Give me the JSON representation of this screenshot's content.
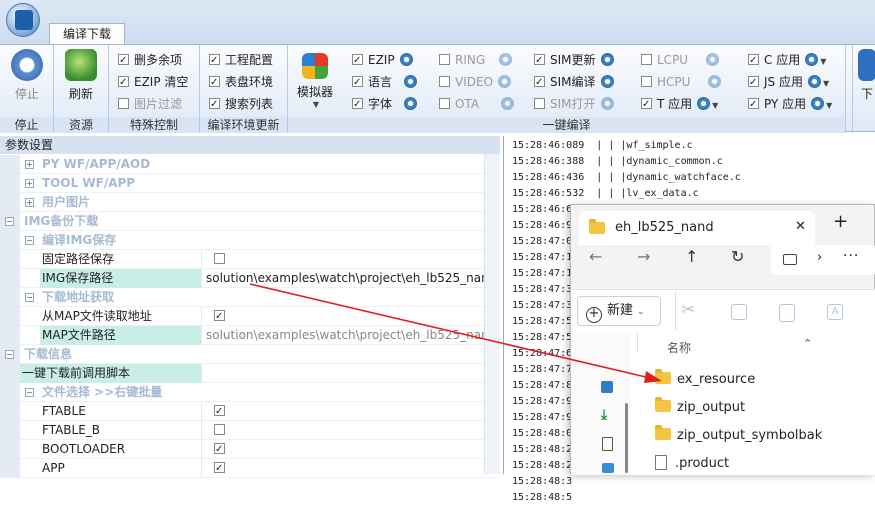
{
  "ribbon": {
    "tab": "编译下载",
    "groups": {
      "stop": {
        "button": "停止",
        "label": "停止"
      },
      "resource": {
        "button": "刷新",
        "label": "资源"
      },
      "special": {
        "items": [
          "删多余项",
          "EZIP 清空",
          "图片过滤"
        ],
        "label": "特殊控制"
      },
      "env": {
        "items": [
          "工程配置",
          "表盘环境",
          "搜索列表"
        ],
        "label": "编译环境更新"
      },
      "simulator": {
        "button": "模拟器"
      },
      "oneclick": {
        "label": "一键编译",
        "col1": [
          "EZIP",
          "语言",
          "字体"
        ],
        "col2": [
          "RING",
          "VIDEO",
          "OTA"
        ],
        "col3": [
          "SIM更新",
          "SIM编译",
          "SIM打开"
        ],
        "col4": [
          "LCPU",
          "HCPU",
          "T 应用"
        ],
        "col5": [
          "C 应用",
          "JS 应用",
          "PY 应用"
        ]
      },
      "download": {
        "button": "下"
      }
    }
  },
  "params": {
    "header": "参数设置",
    "rows": [
      {
        "name": "PY WF/APP/AOD",
        "value": ""
      },
      {
        "name": "TOOL WF/APP",
        "value": ""
      },
      {
        "name": "用户图片",
        "value": ""
      },
      {
        "name": "IMG备份下载",
        "value": ""
      },
      {
        "name": "编译IMG保存",
        "value": ""
      },
      {
        "name": "固定路径保存",
        "value": ""
      },
      {
        "name": "IMG保存路径",
        "value": "solution\\examples\\watch\\project\\eh_lb525_nand\\..."
      },
      {
        "name": "下载地址获取",
        "value": ""
      },
      {
        "name": "从MAP文件读取地址",
        "value": ""
      },
      {
        "name": "MAP文件路径",
        "value": "solution\\examples\\watch\\project\\eh_lb525_nand\\..."
      },
      {
        "name": "下载信息",
        "value": ""
      },
      {
        "name": "一键下载前调用脚本",
        "value": ""
      },
      {
        "name": "文件选择 >>右键批量",
        "value": ""
      },
      {
        "name": "FTABLE",
        "value": ""
      },
      {
        "name": "FTABLE_B",
        "value": ""
      },
      {
        "name": "BOOTLOADER",
        "value": ""
      },
      {
        "name": "APP",
        "value": ""
      }
    ]
  },
  "log": {
    "lines": [
      "15:28:46:089  | | |wf_simple.c",
      "15:28:46:388  | | |dynamic_common.c",
      "15:28:46:436  | | |dynamic_watchface.c",
      "15:28:46:532  | | |lv_ex_data.c",
      "15:28:46:6",
      "15:28:46:9",
      "15:28:47:0",
      "15:28:47:1",
      "15:28:47:1",
      "15:28:47:3",
      "15:28:47:3",
      "15:28:47:5",
      "15:28:47:5",
      "15:28:47:6",
      "15:28:47:7",
      "15:28:47:8",
      "15:28:47:9",
      "15:28:47:9",
      "15:28:48:0",
      "15:28:48:2",
      "15:28:48:2",
      "15:28:48:3",
      "15:28:48:5"
    ]
  },
  "explorer": {
    "tab_title": "eh_lb525_nand",
    "new_tab": "+",
    "close": "✕",
    "new_button": "新建",
    "column_header": "名称",
    "files": [
      "ex_resource",
      "zip_output",
      "zip_output_symbolbak",
      ".product"
    ]
  },
  "colors": {
    "accent": "#e02020",
    "category": "#a7bad3",
    "selected": "#c9eee8"
  }
}
